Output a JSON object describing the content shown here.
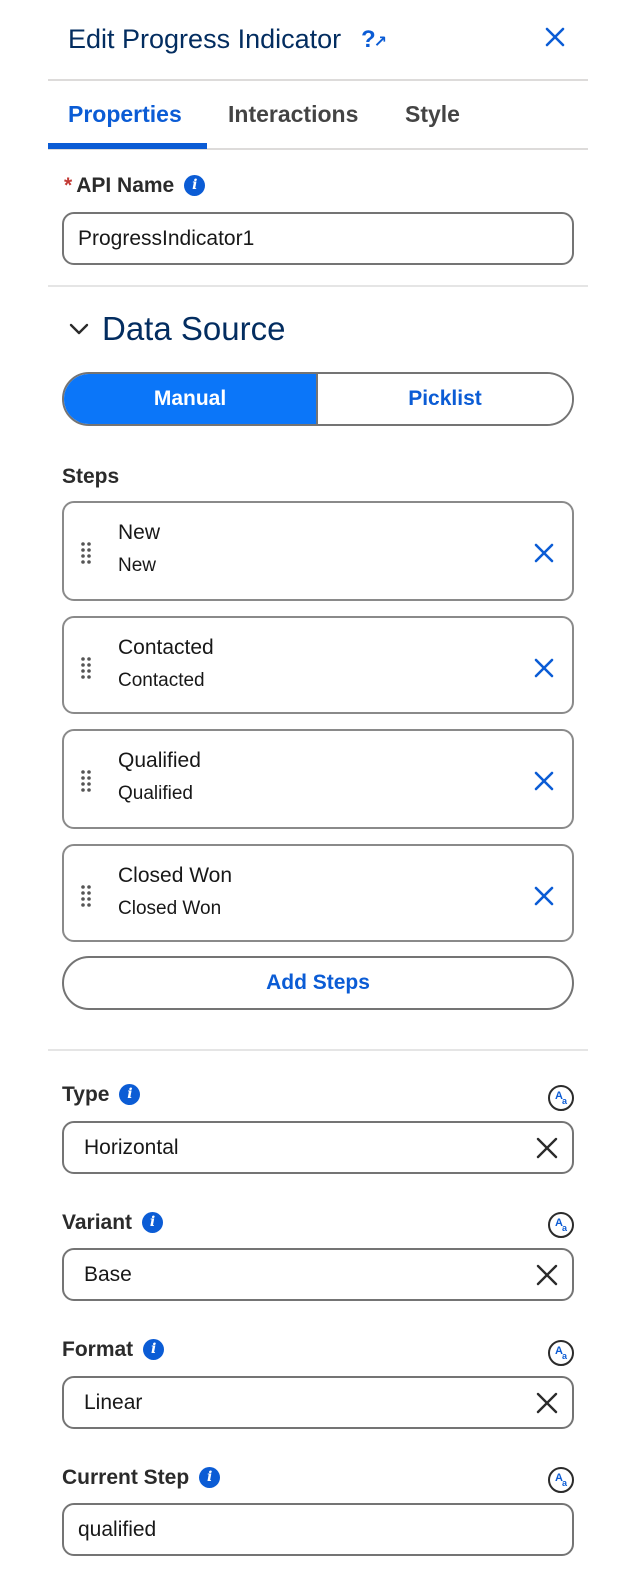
{
  "header": {
    "title": "Edit Progress Indicator",
    "help_glyph": "?",
    "close_icon": "close-icon"
  },
  "tabs": [
    {
      "label": "Properties",
      "active": true
    },
    {
      "label": "Interactions",
      "active": false
    },
    {
      "label": "Style",
      "active": false
    }
  ],
  "api_name": {
    "required_mark": "*",
    "label": "API Name",
    "value": "ProgressIndicator1"
  },
  "data_source": {
    "title": "Data Source",
    "options": [
      {
        "label": "Manual",
        "selected": true
      },
      {
        "label": "Picklist",
        "selected": false
      }
    ],
    "steps_label": "Steps",
    "steps": [
      {
        "label": "New",
        "value": "New"
      },
      {
        "label": "Contacted",
        "value": "Contacted"
      },
      {
        "label": "Qualified",
        "value": "Qualified"
      },
      {
        "label": "Closed Won",
        "value": "Closed Won"
      }
    ],
    "add_label": "Add Steps"
  },
  "fields": {
    "type": {
      "label": "Type",
      "value": "Horizontal"
    },
    "variant": {
      "label": "Variant",
      "value": "Base"
    },
    "format": {
      "label": "Format",
      "value": "Linear"
    },
    "current_step": {
      "label": "Current Step",
      "value": "qualified"
    }
  },
  "colors": {
    "brand": "#0b5cd5",
    "selected": "#0b76f9",
    "title": "#032d60",
    "required": "#c23934"
  }
}
